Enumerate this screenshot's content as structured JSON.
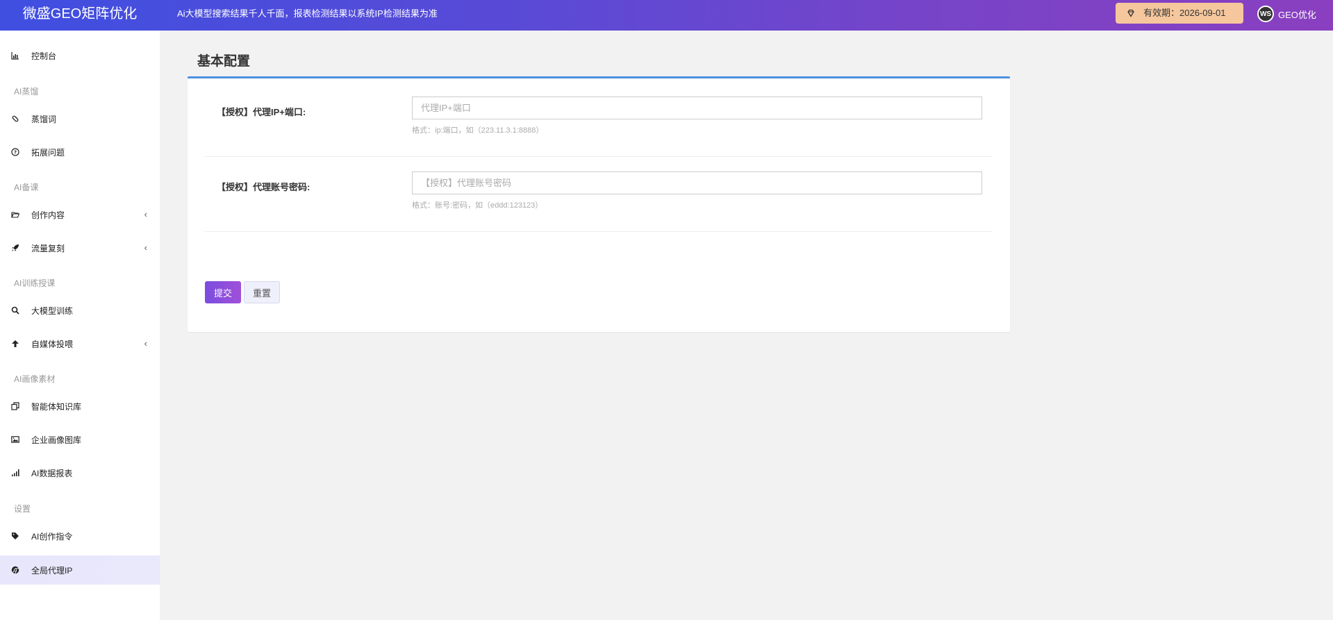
{
  "header": {
    "brand": "微盛GEO矩阵优化",
    "notice": "Ai大模型搜索结果千人千面，报表检测结果以系统IP检测结果为准",
    "expiry": "有效期：2026-09-01",
    "avatar_text": "WS",
    "username": "GEO优化"
  },
  "sidebar": {
    "items": [
      {
        "label": "控制台",
        "icon": "bar-chart-icon"
      },
      {
        "section": "AI蒸馏"
      },
      {
        "label": "蒸馏词",
        "icon": "pill-icon"
      },
      {
        "label": "拓展问题",
        "icon": "question-circle-icon"
      },
      {
        "section": "AI备课"
      },
      {
        "label": "创作内容",
        "icon": "folder-open-icon",
        "expand": "‹"
      },
      {
        "label": "流量复刻",
        "icon": "rocket-icon",
        "expand": "‹"
      },
      {
        "section": "AI训练授课"
      },
      {
        "label": "大模型训练",
        "icon": "search-icon"
      },
      {
        "label": "自媒体投喂",
        "icon": "arrow-up-icon",
        "expand": "‹"
      },
      {
        "section": "AI画像素材"
      },
      {
        "label": "智能体知识库",
        "icon": "copy-icon"
      },
      {
        "label": "企业画像图库",
        "icon": "image-icon"
      },
      {
        "label": "AI数据报表",
        "icon": "signal-icon"
      },
      {
        "section": "设置"
      },
      {
        "label": "AI创作指令",
        "icon": "tag-icon"
      },
      {
        "label": "全局代理IP",
        "icon": "chrome-icon",
        "active": true
      }
    ]
  },
  "main": {
    "title": "基本配置",
    "form": {
      "proxy_ip": {
        "label": "【授权】代理IP+端口:",
        "value": "",
        "placeholder": "代理IP+端口",
        "help": "格式：ip:端口，如（223.11.3.1:8888）"
      },
      "proxy_account": {
        "label": "【授权】代理账号密码:",
        "value": "",
        "placeholder": "【授权】代理账号密码",
        "help": "格式：账号:密码，如（eddd:123123）"
      }
    },
    "buttons": {
      "submit": "提交",
      "reset": "重置"
    }
  }
}
